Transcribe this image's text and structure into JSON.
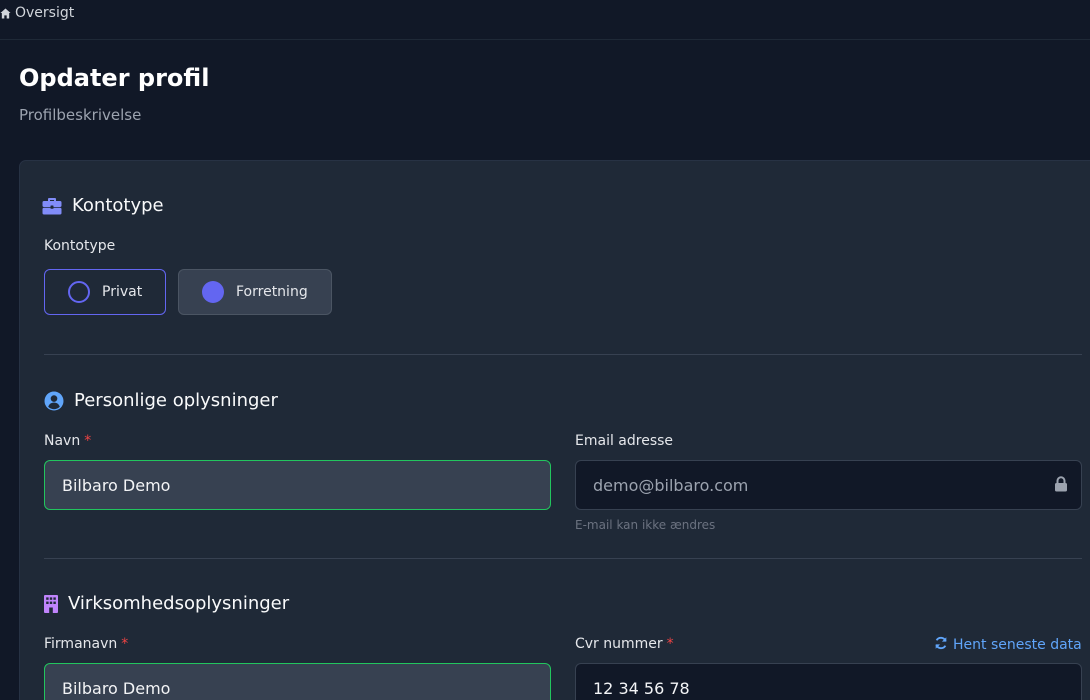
{
  "breadcrumb": {
    "label": "Oversigt"
  },
  "header": {
    "title": "Opdater profil",
    "subtitle": "Profilbeskrivelse"
  },
  "account_type": {
    "section_title": "Kontotype",
    "field_label": "Kontotype",
    "options": [
      {
        "label": "Privat",
        "selected": false
      },
      {
        "label": "Forretning",
        "selected": true
      }
    ]
  },
  "personal": {
    "section_title": "Personlige oplysninger",
    "name_label": "Navn",
    "name_value": "Bilbaro Demo",
    "email_label": "Email adresse",
    "email_value": "demo@bilbaro.com",
    "email_helper": "E-mail kan ikke ændres"
  },
  "business": {
    "section_title": "Virksomhedsoplysninger",
    "company_label": "Firmanavn",
    "company_value": "Bilbaro Demo",
    "cvr_label": "Cvr nummer",
    "cvr_value": "12 34 56 78",
    "fetch_link": "Hent seneste data"
  },
  "required_marker": "*",
  "colors": {
    "background": "#111827",
    "card": "#1f2937",
    "accent": "#6366f1",
    "success_border": "#22c55e",
    "link": "#60a5fa",
    "required": "#ef4444",
    "icon_briefcase": "#818cf8",
    "icon_user": "#60a5fa",
    "icon_building": "#c084fc"
  }
}
